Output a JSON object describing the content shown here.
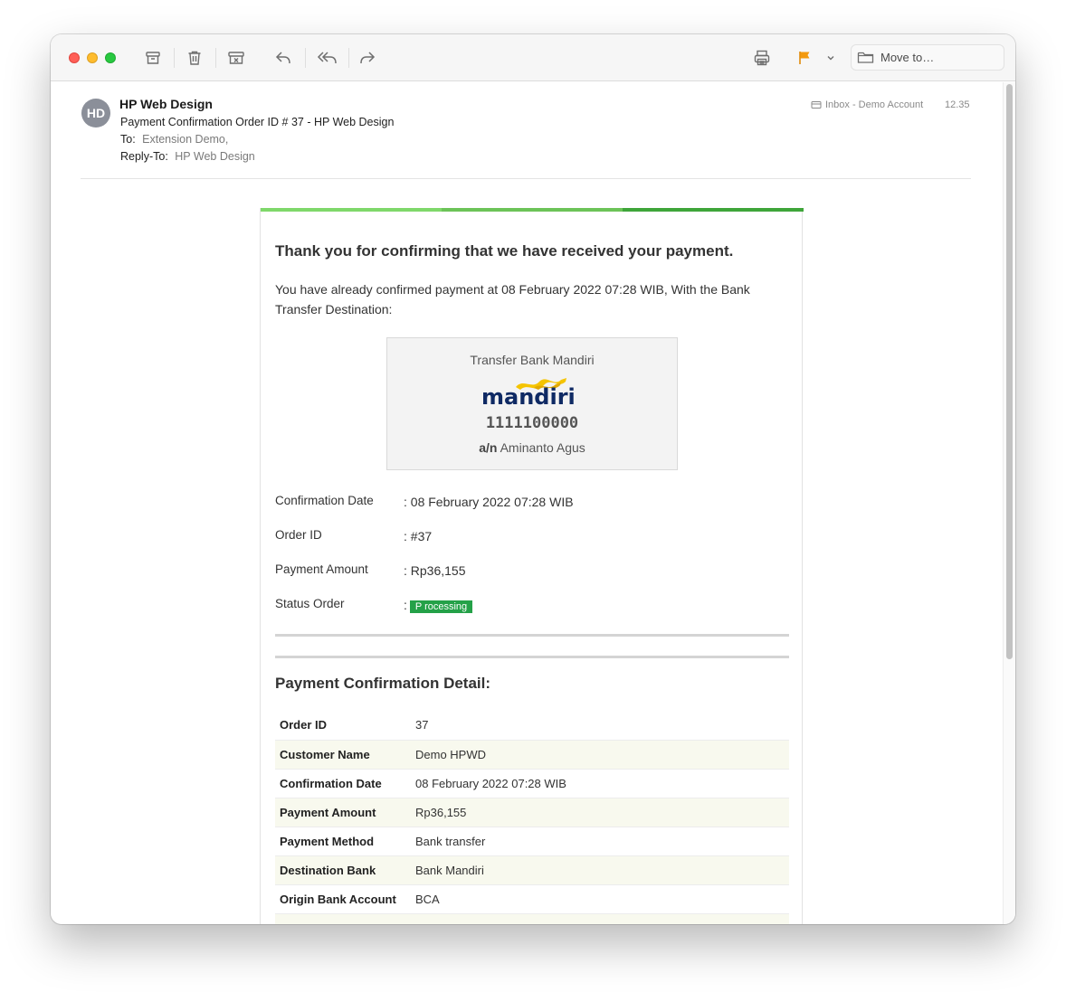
{
  "toolbar": {
    "move_to_label": "Move to…"
  },
  "header": {
    "avatar_initials": "HD",
    "from_name": "HP Web Design",
    "subject": "Payment Confirmation Order ID # 37 - HP Web Design",
    "to_label": "To:",
    "to_value": "Extension Demo,",
    "reply_to_label": "Reply-To:",
    "reply_to_value": "HP Web Design",
    "mailbox": "Inbox - Demo Account",
    "time": "12.35"
  },
  "body": {
    "thanks_heading": "Thank you for confirming that we have received your payment.",
    "intro": "You have already confirmed payment at 08 February 2022 07:28 WIB, With the Bank Transfer Destination:",
    "bank": {
      "title": "Transfer Bank Mandiri",
      "logo_text": "mandiri",
      "account_number": "1111100000",
      "holder_prefix": "a/n",
      "holder_name": "Aminanto Agus"
    },
    "info": [
      {
        "label": "Confirmation Date",
        "value": ": 08 February 2022 07:28 WIB"
      },
      {
        "label": "Order ID",
        "value": ": #37"
      },
      {
        "label": "Payment Amount",
        "value": ": Rp36,155"
      },
      {
        "label": "Status Order",
        "value": ":",
        "badge": "P rocessing"
      }
    ],
    "detail_title": "Payment Confirmation Detail:",
    "detail_rows": [
      {
        "label": "Order ID",
        "value": "37"
      },
      {
        "label": "Customer Name",
        "value": "Demo HPWD"
      },
      {
        "label": "Confirmation Date",
        "value": "08 February 2022 07:28 WIB"
      },
      {
        "label": "Payment Amount",
        "value": "Rp36,155"
      },
      {
        "label": "Payment Method",
        "value": "Bank transfer"
      },
      {
        "label": "Destination Bank",
        "value": "Bank Mandiri"
      },
      {
        "label": "Origin Bank Account",
        "value": "BCA"
      }
    ]
  },
  "colors": {
    "bar_light": "#7fd86a",
    "bar_mid": "#6cc358",
    "bar_dark": "#3fa53a",
    "badge": "#24a148",
    "mandiri_navy": "#0f2a64",
    "mandiri_gold": "#f5c400",
    "flag": "#f39a0f"
  },
  "icons": [
    "archive-icon",
    "trash-icon",
    "junk-icon",
    "reply-icon",
    "reply-all-icon",
    "forward-icon",
    "print-icon",
    "flag-icon",
    "chevron-down-icon",
    "folder-icon",
    "mailbox-icon"
  ]
}
